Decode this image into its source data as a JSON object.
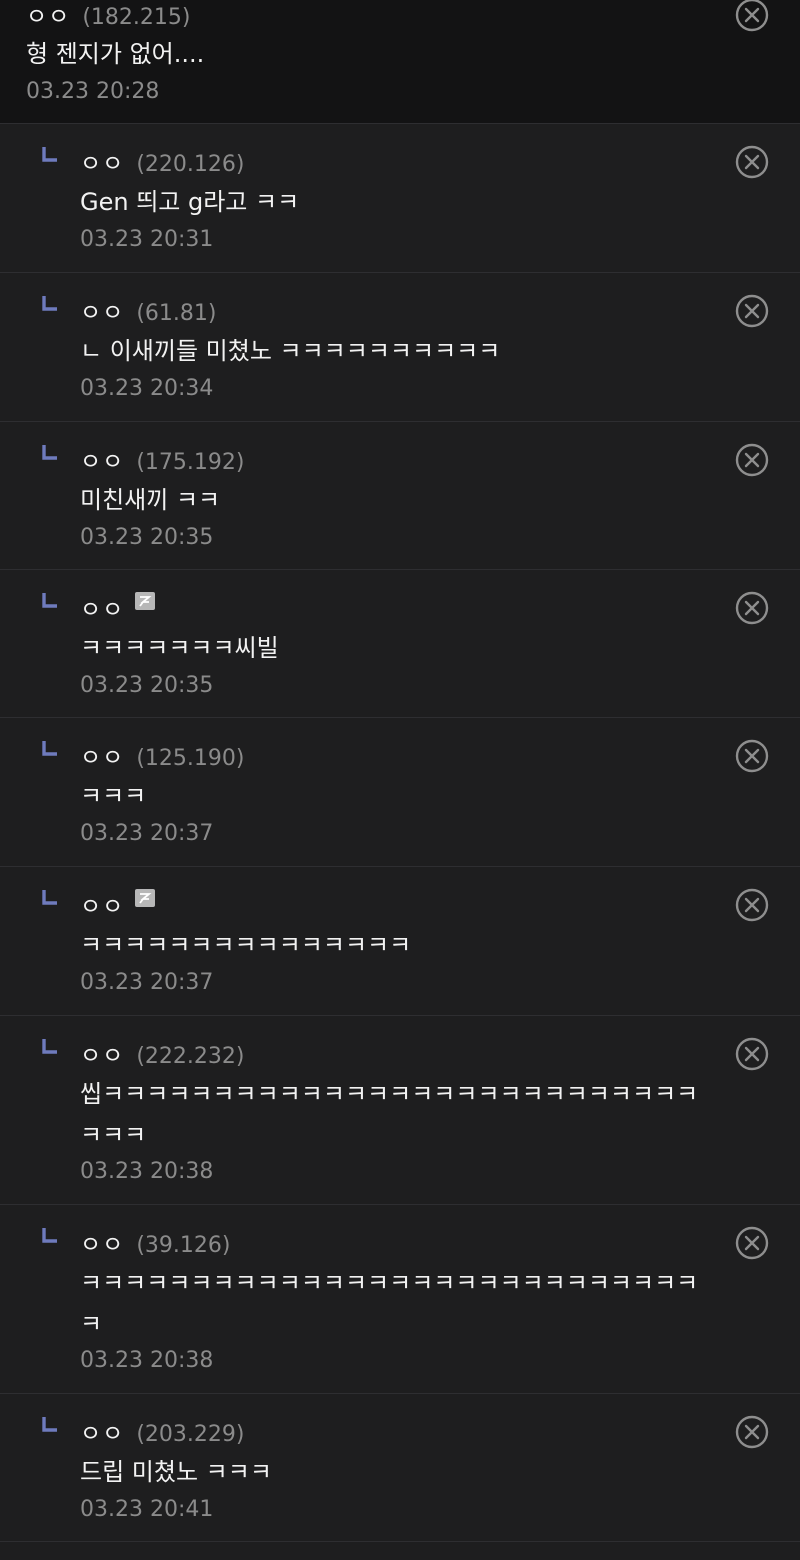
{
  "top_comment": {
    "nick": "ㅇㅇ",
    "ip": "(182.215)",
    "text": "형 젠지가 없어....",
    "date": "03.23 20:28"
  },
  "replies": [
    {
      "nick": "ㅇㅇ",
      "ip": "(220.126)",
      "text": "Gen 띄고 g라고 ㅋㅋ",
      "date": "03.23 20:31"
    },
    {
      "nick": "ㅇㅇ",
      "ip": "(61.81)",
      "text": "ㄴ 이새끼들 미쳤노 ㅋㅋㅋㅋㅋㅋㅋㅋㅋㅋ",
      "date": "03.23 20:34"
    },
    {
      "nick": "ㅇㅇ",
      "ip": "(175.192)",
      "text": "미친새끼 ㅋㅋ",
      "date": "03.23 20:35"
    },
    {
      "nick": "ㅇㅇ",
      "ip": "",
      "text": "ㅋㅋㅋㅋㅋㅋㅋ씨빌",
      "date": "03.23 20:35",
      "badge_icon": "fixed-nick-badge-icon"
    },
    {
      "nick": "ㅇㅇ",
      "ip": "(125.190)",
      "text": "ㅋㅋㅋ",
      "date": "03.23 20:37"
    },
    {
      "nick": "ㅇㅇ",
      "ip": "",
      "text": "ㅋㅋㅋㅋㅋㅋㅋㅋㅋㅋㅋㅋㅋㅋㅋ",
      "date": "03.23 20:37",
      "badge_icon": "fixed-nick-badge-icon"
    },
    {
      "nick": "ㅇㅇ",
      "ip": "(222.232)",
      "text": "씹ㅋㅋㅋㅋㅋㅋㅋㅋㅋㅋㅋㅋㅋㅋㅋㅋㅋㅋㅋㅋㅋㅋㅋㅋㅋㅋㅋ\nㅋㅋㅋ",
      "date": "03.23 20:38"
    },
    {
      "nick": "ㅇㅇ",
      "ip": "(39.126)",
      "text": "ㅋㅋㅋㅋㅋㅋㅋㅋㅋㅋㅋㅋㅋㅋㅋㅋㅋㅋㅋㅋㅋㅋㅋㅋㅋㅋㅋㅋ\nㅋ",
      "date": "03.23 20:38"
    },
    {
      "nick": "ㅇㅇ",
      "ip": "(203.229)",
      "text": "드립 미쳤노 ㅋㅋㅋ",
      "date": "03.23 20:41"
    }
  ],
  "colors": {
    "background": "#1e1e1f",
    "top_comment_background": "#131314",
    "reply_arrow": "#6f7bbd",
    "text": "#f2f2f2",
    "meta": "#8b8b8b",
    "divider": "#2e2e31"
  },
  "icons": {
    "reply": "reply-arrow-icon",
    "delete": "delete-circle-x-icon",
    "badge": "fixed-nick-badge-icon"
  }
}
